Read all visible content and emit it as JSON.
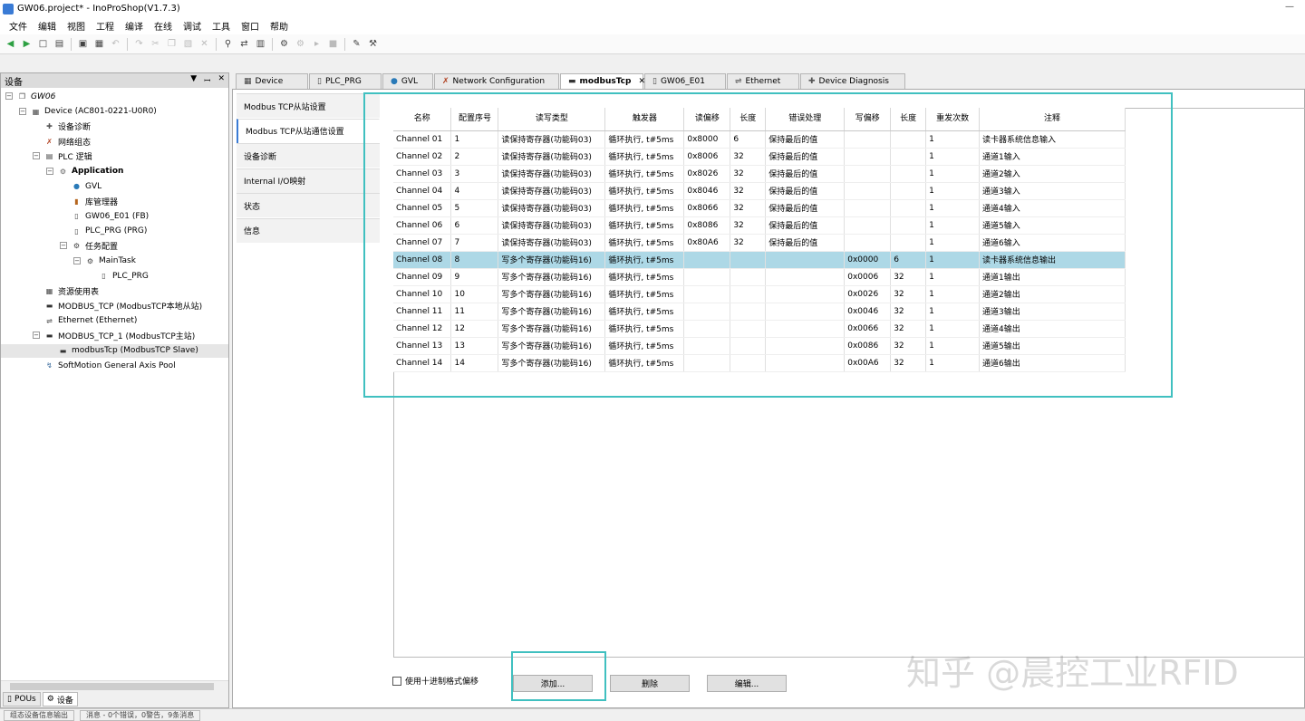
{
  "window": {
    "title": "GW06.project* - InoProShop(V1.7.3)"
  },
  "menu": [
    "文件",
    "编辑",
    "视图",
    "工程",
    "编译",
    "在线",
    "调试",
    "工具",
    "窗口",
    "帮助"
  ],
  "toolbar_icons": [
    "back-icon",
    "forward-icon",
    "new-icon",
    "open-icon",
    "save-icon",
    "print-icon",
    "undo-icon",
    "redo-icon",
    "cut-icon",
    "copy-icon",
    "paste-icon",
    "delete-icon",
    "find-icon",
    "replace-icon",
    "build-icon",
    "login-icon",
    "logout-icon",
    "run-icon",
    "stop-icon",
    "settings-icon",
    "tool-icon"
  ],
  "device_panel": {
    "title": "设备",
    "tree": [
      {
        "label": "GW06",
        "indent": 0,
        "icon": "project-icon"
      },
      {
        "label": "Device (AC801-0221-U0R0)",
        "indent": 1,
        "icon": "device-icon"
      },
      {
        "label": "设备诊断",
        "indent": 2,
        "icon": "diagnose-icon"
      },
      {
        "label": "网络组态",
        "indent": 2,
        "icon": "network-icon"
      },
      {
        "label": "PLC 逻辑",
        "indent": 2,
        "icon": "plc-icon"
      },
      {
        "label": "Application",
        "indent": 3,
        "icon": "gear-icon"
      },
      {
        "label": "GVL",
        "indent": 4,
        "icon": "globe-icon"
      },
      {
        "label": "库管理器",
        "indent": 4,
        "icon": "library-icon"
      },
      {
        "label": "GW06_E01 (FB)",
        "indent": 4,
        "icon": "pou-icon"
      },
      {
        "label": "PLC_PRG (PRG)",
        "indent": 4,
        "icon": "pou-icon"
      },
      {
        "label": "任务配置",
        "indent": 4,
        "icon": "task-icon"
      },
      {
        "label": "MainTask",
        "indent": 5,
        "icon": "task-icon"
      },
      {
        "label": "PLC_PRG",
        "indent": 6,
        "icon": "pou-icon"
      },
      {
        "label": "资源使用表",
        "indent": 2,
        "icon": "table-icon"
      },
      {
        "label": "MODBUS_TCP (ModbusTCP本地从站)",
        "indent": 2,
        "icon": "module-icon"
      },
      {
        "label": "Ethernet (Ethernet)",
        "indent": 2,
        "icon": "ethernet-icon"
      },
      {
        "label": "MODBUS_TCP_1 (ModbusTCP主站)",
        "indent": 2,
        "icon": "module-icon"
      },
      {
        "label": "modbusTcp (ModbusTCP Slave)",
        "indent": 3,
        "icon": "module-icon"
      },
      {
        "label": "SoftMotion General Axis Pool",
        "indent": 2,
        "icon": "axis-icon"
      }
    ],
    "bottom_tabs": [
      "POUs",
      "设备"
    ]
  },
  "editor_tabs": [
    {
      "label": "Device",
      "icon": "device-icon"
    },
    {
      "label": "PLC_PRG",
      "icon": "pou-icon"
    },
    {
      "label": "GVL",
      "icon": "globe-icon"
    },
    {
      "label": "Network Configuration",
      "icon": "network-icon"
    },
    {
      "label": "modbusTcp",
      "icon": "module-icon"
    },
    {
      "label": "GW06_E01",
      "icon": "pou-icon"
    },
    {
      "label": "Ethernet",
      "icon": "ethernet-icon"
    },
    {
      "label": "Device Diagnosis",
      "icon": "diagnose-icon"
    }
  ],
  "side_tabs": [
    "Modbus TCP从站设置",
    "Modbus TCP从站通信设置",
    "设备诊断",
    "Internal I/O映射",
    "状态",
    "信息"
  ],
  "table": {
    "headers": [
      "名称",
      "配置序号",
      "读写类型",
      "触发器",
      "读偏移",
      "长度",
      "错误处理",
      "写偏移",
      "长度",
      "重发次数",
      "注释"
    ],
    "rows": [
      [
        "Channel 01",
        "1",
        "读保持寄存器(功能码03)",
        "循环执行, t#5ms",
        "0x8000",
        "6",
        "保持最后的值",
        "",
        "",
        "1",
        "读卡器系统信息输入"
      ],
      [
        "Channel 02",
        "2",
        "读保持寄存器(功能码03)",
        "循环执行, t#5ms",
        "0x8006",
        "32",
        "保持最后的值",
        "",
        "",
        "1",
        "通道1输入"
      ],
      [
        "Channel 03",
        "3",
        "读保持寄存器(功能码03)",
        "循环执行, t#5ms",
        "0x8026",
        "32",
        "保持最后的值",
        "",
        "",
        "1",
        "通道2输入"
      ],
      [
        "Channel 04",
        "4",
        "读保持寄存器(功能码03)",
        "循环执行, t#5ms",
        "0x8046",
        "32",
        "保持最后的值",
        "",
        "",
        "1",
        "通道3输入"
      ],
      [
        "Channel 05",
        "5",
        "读保持寄存器(功能码03)",
        "循环执行, t#5ms",
        "0x8066",
        "32",
        "保持最后的值",
        "",
        "",
        "1",
        "通道4输入"
      ],
      [
        "Channel 06",
        "6",
        "读保持寄存器(功能码03)",
        "循环执行, t#5ms",
        "0x8086",
        "32",
        "保持最后的值",
        "",
        "",
        "1",
        "通道5输入"
      ],
      [
        "Channel 07",
        "7",
        "读保持寄存器(功能码03)",
        "循环执行, t#5ms",
        "0x80A6",
        "32",
        "保持最后的值",
        "",
        "",
        "1",
        "通道6输入"
      ],
      [
        "Channel 08",
        "8",
        "写多个寄存器(功能码16)",
        "循环执行, t#5ms",
        "",
        "",
        "",
        "0x0000",
        "6",
        "1",
        "读卡器系统信息输出"
      ],
      [
        "Channel 09",
        "9",
        "写多个寄存器(功能码16)",
        "循环执行, t#5ms",
        "",
        "",
        "",
        "0x0006",
        "32",
        "1",
        "通道1输出"
      ],
      [
        "Channel 10",
        "10",
        "写多个寄存器(功能码16)",
        "循环执行, t#5ms",
        "",
        "",
        "",
        "0x0026",
        "32",
        "1",
        "通道2输出"
      ],
      [
        "Channel 11",
        "11",
        "写多个寄存器(功能码16)",
        "循环执行, t#5ms",
        "",
        "",
        "",
        "0x0046",
        "32",
        "1",
        "通道3输出"
      ],
      [
        "Channel 12",
        "12",
        "写多个寄存器(功能码16)",
        "循环执行, t#5ms",
        "",
        "",
        "",
        "0x0066",
        "32",
        "1",
        "通道4输出"
      ],
      [
        "Channel 13",
        "13",
        "写多个寄存器(功能码16)",
        "循环执行, t#5ms",
        "",
        "",
        "",
        "0x0086",
        "32",
        "1",
        "通道5输出"
      ],
      [
        "Channel 14",
        "14",
        "写多个寄存器(功能码16)",
        "循环执行, t#5ms",
        "",
        "",
        "",
        "0x00A6",
        "32",
        "1",
        "通道6输出"
      ]
    ],
    "selected_row": 7
  },
  "footer": {
    "decimal_label": "使用十进制格式偏移",
    "add": "添加...",
    "delete": "删除",
    "edit": "编辑..."
  },
  "status": {
    "left": "组态设备信息输出",
    "messages": "消息 - 0个错误，0警告，9条消息"
  },
  "watermark": "知乎 @晨控工业RFID",
  "colors": {
    "highlight": "#40c0c0",
    "selected_row": "#add8e6"
  }
}
